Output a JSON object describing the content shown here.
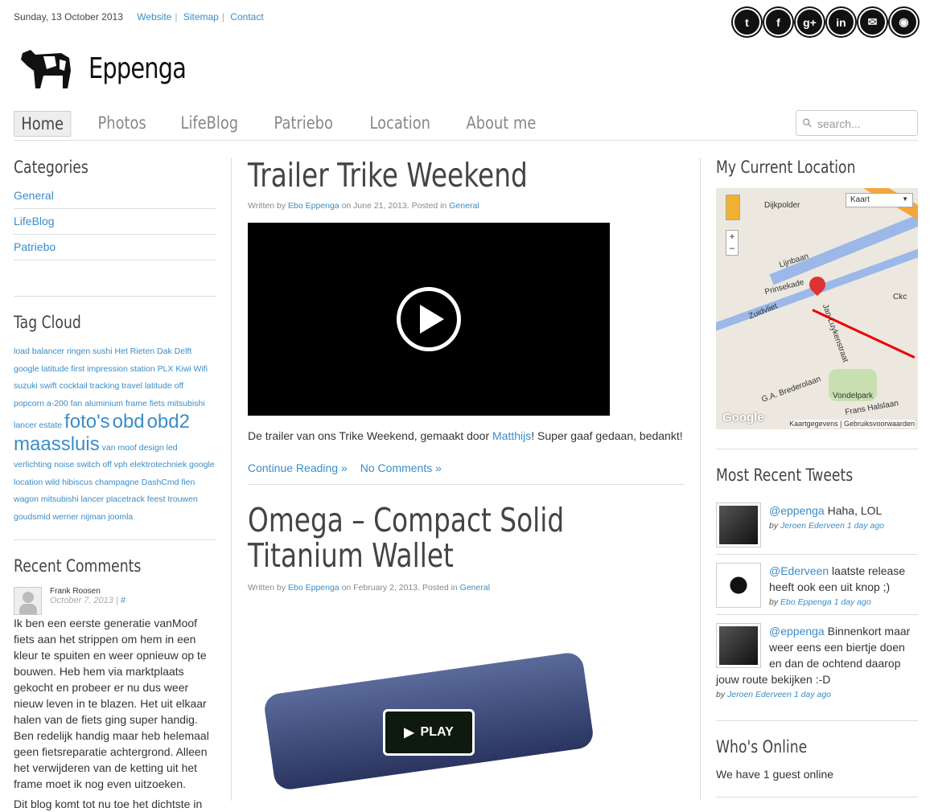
{
  "topbar": {
    "date": "Sunday, 13 October 2013",
    "links": [
      "Website",
      "Sitemap",
      "Contact"
    ]
  },
  "social": [
    {
      "icon": "twitter-icon",
      "glyph": "t"
    },
    {
      "icon": "facebook-icon",
      "glyph": "f"
    },
    {
      "icon": "google-plus-icon",
      "glyph": "g+"
    },
    {
      "icon": "linkedin-icon",
      "glyph": "in"
    },
    {
      "icon": "email-icon",
      "glyph": "✉"
    },
    {
      "icon": "rss-icon",
      "glyph": "◉"
    }
  ],
  "site": {
    "title": "Eppenga"
  },
  "nav": [
    "Home",
    "Photos",
    "LifeBlog",
    "Patriebo",
    "Location",
    "About me"
  ],
  "search": {
    "placeholder": "search..."
  },
  "sidebar": {
    "categories_title": "Categories",
    "categories": [
      "General",
      "LifeBlog",
      "Patriebo"
    ],
    "tagcloud_title": "Tag Cloud",
    "tags": [
      "load balancer",
      "ringen",
      "sushi",
      "Het Rieten Dak",
      "Delft",
      "google latitude",
      "first impression",
      "station",
      "PLX Kiwi Wifi",
      "suzuki swift",
      "cocktail",
      "tracking",
      "travel",
      "latitude off",
      "popcorn",
      "a-200",
      "fan",
      "aluminium frame",
      "fiets",
      "mitsubishi lancer estate",
      "foto's",
      "obd",
      "obd2",
      "maassluis",
      "van moof design",
      "led verlichting",
      "noise",
      "switch off",
      "vph elektrotechniek",
      "google location",
      "wild hibiscus",
      "champagne",
      "DashCmd",
      "fien",
      "wagon",
      "mitsubishi lancer",
      "placetrack",
      "feest",
      "trouwen",
      "goudsmid",
      "werner nijman",
      "joomla"
    ],
    "big_tags": [
      "foto's",
      "obd",
      "obd2",
      "maassluis"
    ],
    "comments_title": "Recent Comments",
    "comment": {
      "author": "Frank Roosen",
      "date": "October 7, 2013",
      "sep": " | ",
      "link": "#",
      "text": "Ik ben een eerste generatie vanMoof fiets aan het strippen om hem in een kleur te spuiten en weer opnieuw op te bouwen. Heb hem via marktplaats gekocht en probeer er nu dus weer nieuw leven in te blazen. Het uit elkaar halen van de fiets ging super handig. Ben redelijk handig maar heb helemaal geen fietsreparatie achtergrond. Alleen het verwijderen van de ketting uit het frame moet ik nog even uitzoeken.",
      "text2": "Dit blog komt tot nu toe het dichtste in"
    }
  },
  "posts": [
    {
      "title": "Trailer Trike Weekend",
      "meta_pre": "Written by ",
      "author": "Ebo Eppenga",
      "meta_mid": " on June 21, 2013. Posted in ",
      "category": "General",
      "body_pre": "De trailer van ons Trike Weekend, gemaakt door ",
      "body_link": "Matthijs",
      "body_post": "! Super gaaf gedaan, bedankt!",
      "continue": "Continue Reading »",
      "comments": "No Comments »"
    },
    {
      "title": "Omega – Compact Solid Titanium Wallet",
      "meta_pre": "Written by ",
      "author": "Ebo Eppenga",
      "meta_mid": " on February 2, 2013. Posted in ",
      "category": "General",
      "play": "PLAY"
    }
  ],
  "right": {
    "location_title": "My Current Location",
    "map": {
      "type_select": "Kaart",
      "labels": [
        "Dijkpolder",
        "Lijnbaan",
        "Prinsekade",
        "Zuidvliet",
        "Jan Luykenstraat",
        "G.A. Brederolaan",
        "Vondelpark",
        "Frans Halslaan",
        "Ckc"
      ],
      "footer": "Kaartgegevens | Gebruiksvoorwaarden",
      "brand": "Google"
    },
    "tweets_title": "Most Recent Tweets",
    "tweets": [
      {
        "handle": "@eppenga",
        "text": " Haha, LOL",
        "by": "by ",
        "who": "Jeroen Ederveen 1 day ago",
        "avatar": "person"
      },
      {
        "handle": "@Ederveen",
        "text": " laatste release heeft ook een uit knop ;)",
        "by": "by ",
        "who": "Ebo Eppenga 1 day ago",
        "avatar": "cow"
      },
      {
        "handle": "@eppenga",
        "text": " Binnenkort maar weer eens een biertje doen en dan de ochtend daarop jouw route bekijken :-D",
        "by": "by ",
        "who": "Jeroen Ederveen 1 day ago",
        "avatar": "person"
      }
    ],
    "online_title": "Who's Online",
    "online_text": "We have 1 guest online"
  }
}
